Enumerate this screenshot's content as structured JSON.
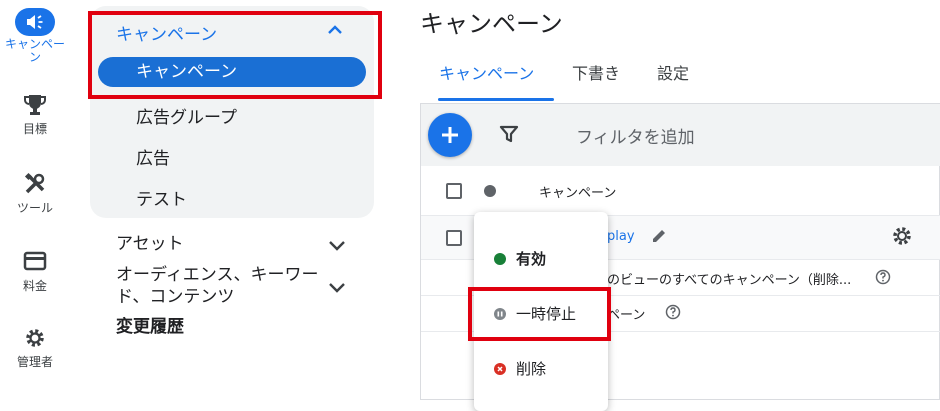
{
  "rail": {
    "items": [
      {
        "label": "キャンペーン",
        "icon": "megaphone-icon"
      },
      {
        "label": "目標",
        "icon": "trophy-icon"
      },
      {
        "label": "ツール",
        "icon": "tools-icon"
      },
      {
        "label": "料金",
        "icon": "credit-card-icon"
      },
      {
        "label": "管理者",
        "icon": "gear-icon"
      }
    ]
  },
  "nav": {
    "section_title": "キャンペーン",
    "selected": "キャンペーン",
    "sub_items": [
      "広告グループ",
      "広告",
      "テスト"
    ],
    "sections": [
      "アセット",
      "オーディエンス、キーワード、コンテンツ",
      "変更履歴"
    ]
  },
  "main": {
    "title": "キャンペーン",
    "tabs": [
      "キャンペーン",
      "下書き",
      "設定"
    ],
    "filter_placeholder": "フィルタを追加",
    "header_col": "キャンペーン",
    "row1_link": "play",
    "row2_text": "のビューのすべてのキャンペーン（削除...",
    "row3_text": "ペーン"
  },
  "menu": {
    "items": [
      {
        "label": "有効",
        "status": "enabled",
        "color": "#188038"
      },
      {
        "label": "一時停止",
        "status": "paused",
        "color": "#80868b"
      },
      {
        "label": "削除",
        "status": "removed",
        "color": "#d93025"
      }
    ]
  },
  "colors": {
    "accent": "#1a73e8",
    "highlight_box": "#e0000f"
  }
}
